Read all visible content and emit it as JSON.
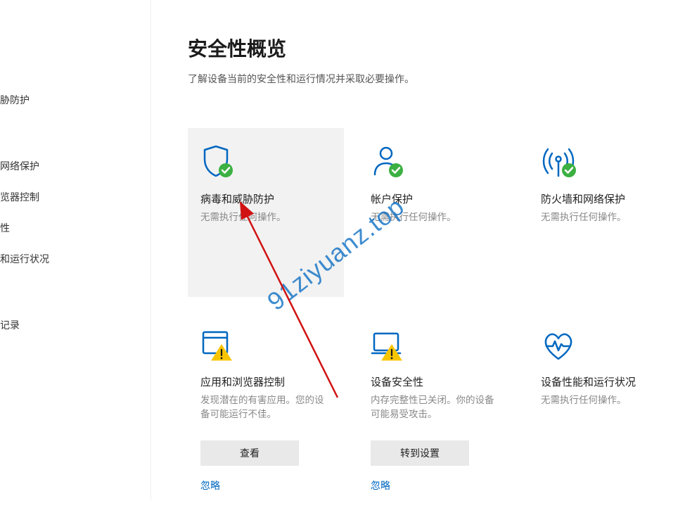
{
  "sidebar": {
    "items": [
      {
        "label": "胁防护"
      },
      {
        "label": "网络保护"
      },
      {
        "label": "览器控制"
      },
      {
        "label": "性"
      },
      {
        "label": "和运行状况"
      },
      {
        "label": "记录"
      }
    ]
  },
  "page": {
    "title": "安全性概览",
    "subtitle": "了解设备当前的安全性和运行情况并采取必要操作。"
  },
  "cards": [
    {
      "icon": "shield-check-icon",
      "title": "病毒和威胁防护",
      "desc": "无需执行任何操作。"
    },
    {
      "icon": "account-check-icon",
      "title": "帐户保护",
      "desc": "无需执行任何操作。"
    },
    {
      "icon": "antenna-check-icon",
      "title": "防火墙和网络保护",
      "desc": "无需执行任何操作。"
    },
    {
      "icon": "app-warn-icon",
      "title": "应用和浏览器控制",
      "desc": "发现潜在的有害应用。您的设备可能运行不佳。",
      "action": "查看",
      "link": "忽略"
    },
    {
      "icon": "device-warn-icon",
      "title": "设备安全性",
      "desc": "内存完整性已关闭。你的设备可能易受攻击。",
      "action": "转到设置",
      "link": "忽略"
    },
    {
      "icon": "perf-icon",
      "title": "设备性能和运行状况",
      "desc": "无需执行任何操作。"
    }
  ],
  "watermark": "91ziyuanz.top"
}
